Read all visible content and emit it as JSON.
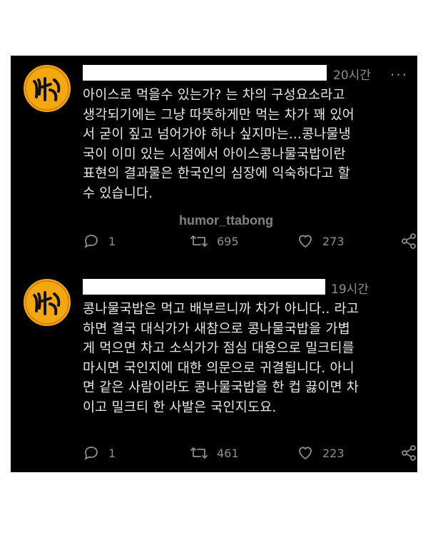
{
  "tweets": [
    {
      "time": "20시간",
      "more": "···",
      "text": "아이스로 먹을수 있는가? 는 차의 구성요소라고\n생각되기에는 그냥 따뜻하게만 먹는 차가 꽤 있어\n서 굳이 짚고 넘어가야 하나 싶지마는...콩나물냉\n국이 이미 있는 시점에서 아이스콩나물국밥이란\n표현의 결과물은 한국인의 심장에 익숙하다고 할\n수 있습니다.",
      "watermark": "humor_ttabong",
      "reply_count": "1",
      "retweet_count": "695",
      "like_count": "273"
    },
    {
      "time": "19시간",
      "text": "콩나물국밥은 먹고 배부르니까 차가 아니다.. 라고\n하면 결국 대식가가 새참으로 콩나물국밥을 가볍\n게 먹으면 차고 소식가가 점심 대용으로 밀크티를\n마시면 국인지에 대한 의문으로 귀결됩니다. 아니\n면 같은 사람이라도 콩나물국밥을 한 컵 끓이면 차\n이고 밀크티 한 사발은 국인지도요.",
      "reply_count": "1",
      "retweet_count": "461",
      "like_count": "223"
    }
  ],
  "icons": {
    "avatar": "yellow-circle-avatar",
    "reply": "reply-icon",
    "retweet": "retweet-icon",
    "like": "heart-icon",
    "share": "share-icon",
    "more": "more-icon"
  }
}
